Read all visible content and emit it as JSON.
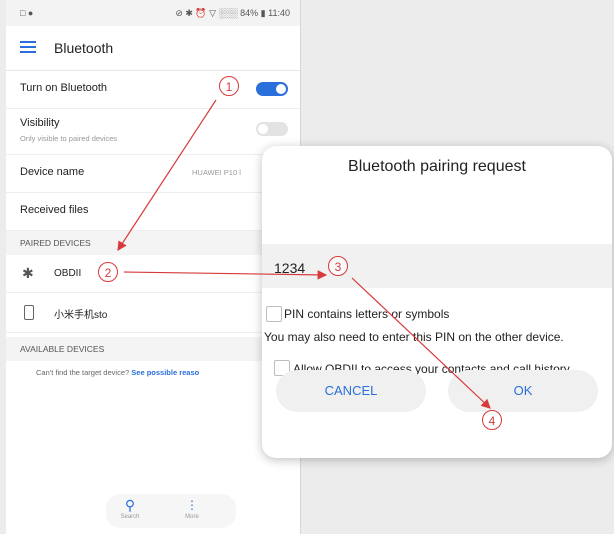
{
  "status_bar": {
    "left": "□ ●",
    "right": "⊘ ✱ ⏰ ▽ ░░░ 84% ▮ 11:40"
  },
  "header": {
    "title": "Bluetooth"
  },
  "settings": {
    "turn_on_label": "Turn on Bluetooth",
    "bluetooth_on": true,
    "visibility_label": "Visibility",
    "visibility_sub": "Only visible to paired devices",
    "visibility_on": false,
    "device_name_label": "Device name",
    "device_name_value": "HUAWEI P10 l",
    "received_files_label": "Received files"
  },
  "paired": {
    "header": "PAIRED DEVICES",
    "items": [
      {
        "icon": "bluetooth-icon",
        "name": "OBDII"
      },
      {
        "icon": "phone-icon",
        "name": "小米手机sto"
      }
    ]
  },
  "available": {
    "header": "AVAILABLE DEVICES",
    "hint": "Can't find the target device?",
    "link": "See possible reaso"
  },
  "bottom_nav": [
    {
      "icon": "search-icon",
      "label": "Search"
    },
    {
      "icon": "more-icon",
      "label": "More"
    }
  ],
  "dialog": {
    "title": "Bluetooth pairing request",
    "pin": "1234",
    "pin_letters_label": "PIN contains letters or symbols",
    "pin_letters_checked": false,
    "hint": "You may also need to enter this PIN on the other device.",
    "allow_label": "Allow OBDII to access your contacts and call history",
    "allow_checked": false,
    "cancel_label": "CANCEL",
    "ok_label": "OK"
  },
  "annotations": [
    "1",
    "2",
    "3",
    "4"
  ],
  "colors": {
    "accent": "#2a6fdb",
    "annotation": "#d63a3a",
    "toggle_off": "#e3e3e3"
  }
}
